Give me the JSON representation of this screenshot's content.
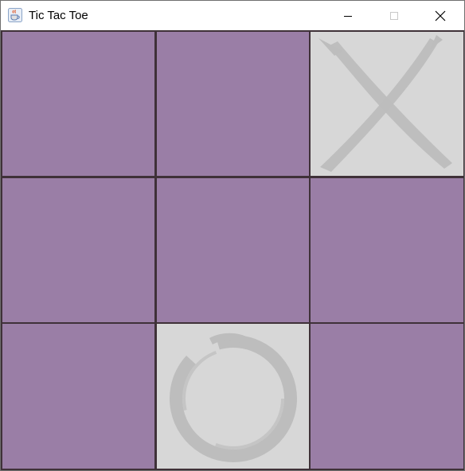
{
  "window": {
    "title": "Tic Tac Toe",
    "app_icon": "java-cup-icon",
    "controls": [
      "minimize-icon",
      "maximize-icon",
      "close-icon"
    ]
  },
  "colors": {
    "empty_cell": "#9a7ea6",
    "filled_cell": "#d7d7d7",
    "mark": "#bdbdbd",
    "grid_line": "#3f3138"
  },
  "board": {
    "rows": 3,
    "cols": 3,
    "cells": [
      [
        "",
        "",
        "X"
      ],
      [
        "",
        "",
        ""
      ],
      [
        "",
        "O",
        ""
      ]
    ]
  }
}
